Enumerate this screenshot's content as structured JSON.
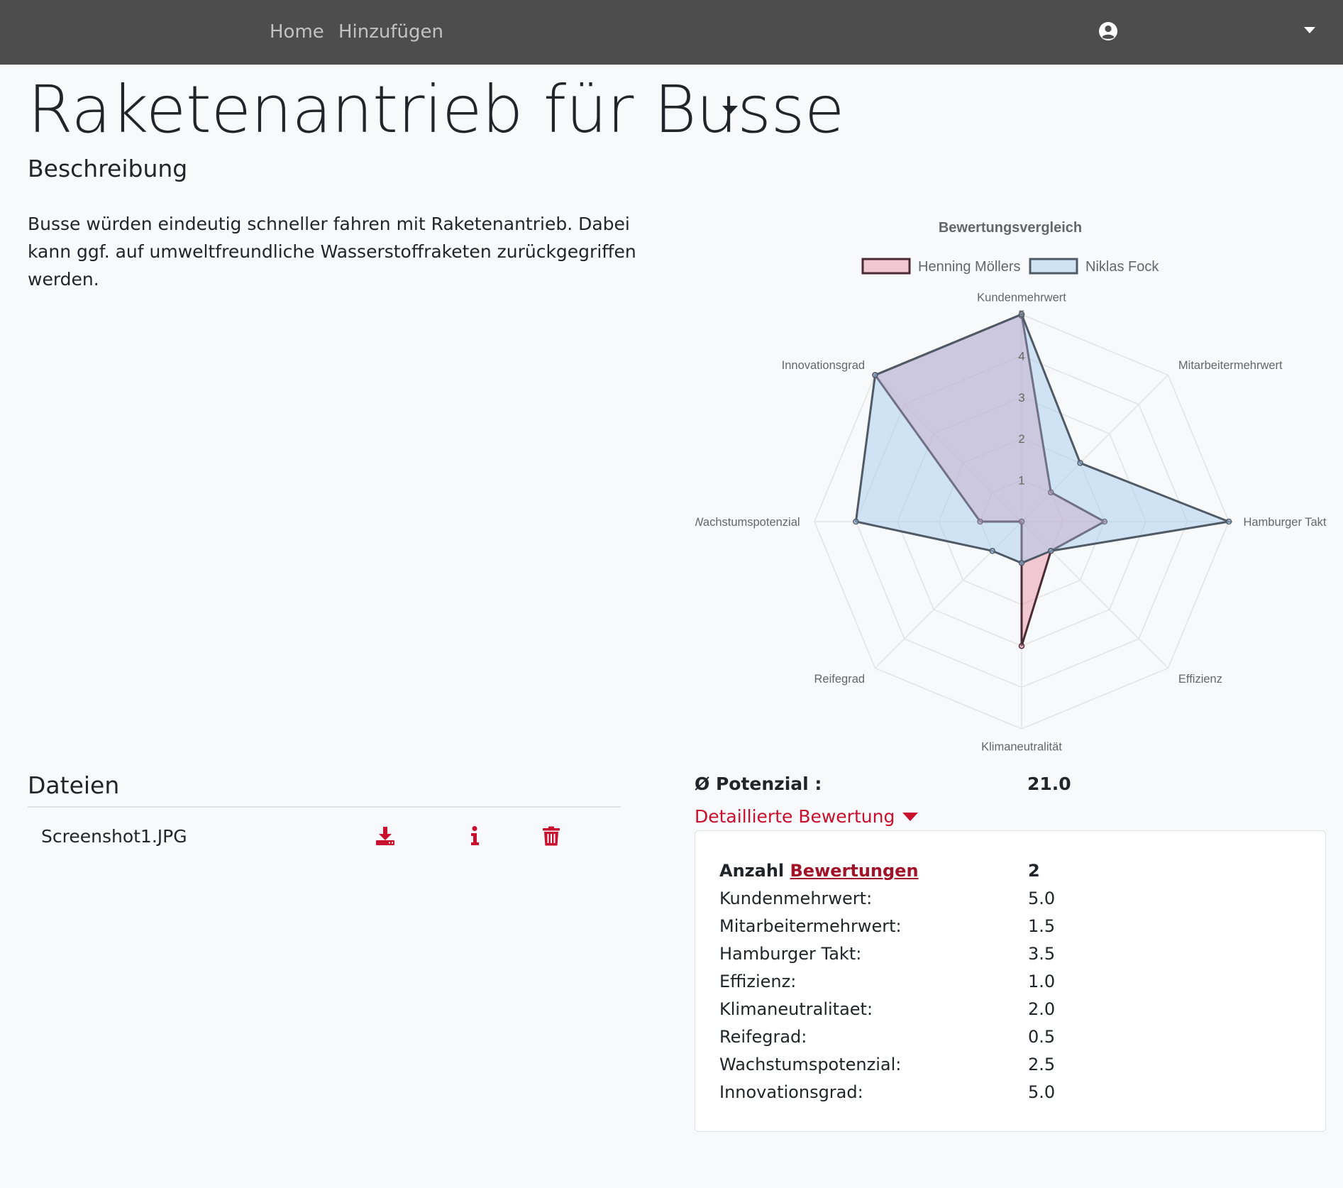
{
  "nav": {
    "home_label": "Home",
    "add_label": "Hinzufügen"
  },
  "page": {
    "title": "Raketenantrieb für Busse",
    "description_heading": "Beschreibung",
    "description": "Busse würden eindeutig schneller fahren mit Raketenantrieb. Dabei kann ggf. auf umweltfreundliche Wasserstoffraketen zurückgegriffen werden."
  },
  "files": {
    "heading": "Dateien",
    "items": [
      {
        "name": "Screenshot1.JPG"
      }
    ]
  },
  "potential": {
    "label": "Ø Potenzial :",
    "value": "21.0"
  },
  "details": {
    "toggle_label": "Detaillierte Bewertung",
    "count_label": "Anzahl",
    "count_link": "Bewertungen",
    "count_value": "2",
    "rows": [
      {
        "label": "Kundenmehrwert:",
        "value": "5.0"
      },
      {
        "label": "Mitarbeitermehrwert:",
        "value": "1.5"
      },
      {
        "label": "Hamburger Takt:",
        "value": "3.5"
      },
      {
        "label": "Effizienz:",
        "value": "1.0"
      },
      {
        "label": "Klimaneutralitaet:",
        "value": "2.0"
      },
      {
        "label": "Reifegrad:",
        "value": "0.5"
      },
      {
        "label": "Wachstumspotenzial:",
        "value": "2.5"
      },
      {
        "label": "Innovationsgrad:",
        "value": "5.0"
      }
    ]
  },
  "colors": {
    "accent": "#c8102e",
    "navbar": "#4d4d4d"
  },
  "icons": {
    "download": "download-icon",
    "info": "info-icon",
    "delete": "trash-icon",
    "user": "user-circle-icon"
  },
  "chart_data": {
    "type": "radar",
    "title": "Bewertungsvergleich",
    "categories": [
      "Kundenmehrwert",
      "Mitarbeitermehrwert",
      "Hamburger Takt",
      "Effizienz",
      "Klimaneutralität",
      "Reifegrad",
      "Wachstumspotenzial",
      "Innovationsgrad"
    ],
    "rlim": [
      0,
      5
    ],
    "ticks": [
      "1",
      "2",
      "3",
      "4",
      "5"
    ],
    "legend": "top",
    "grid": true,
    "series": [
      {
        "name": "Henning Möllers",
        "values": [
          5,
          1,
          2,
          1,
          3,
          0,
          1,
          5
        ],
        "fill": "rgba(232,140,160,0.45)",
        "stroke": "#4a2a33"
      },
      {
        "name": "Niklas Fock",
        "values": [
          5,
          2,
          5,
          1,
          1,
          1,
          4,
          5
        ],
        "fill": "rgba(160,200,240,0.45)",
        "stroke": "#4f5a66"
      }
    ]
  }
}
